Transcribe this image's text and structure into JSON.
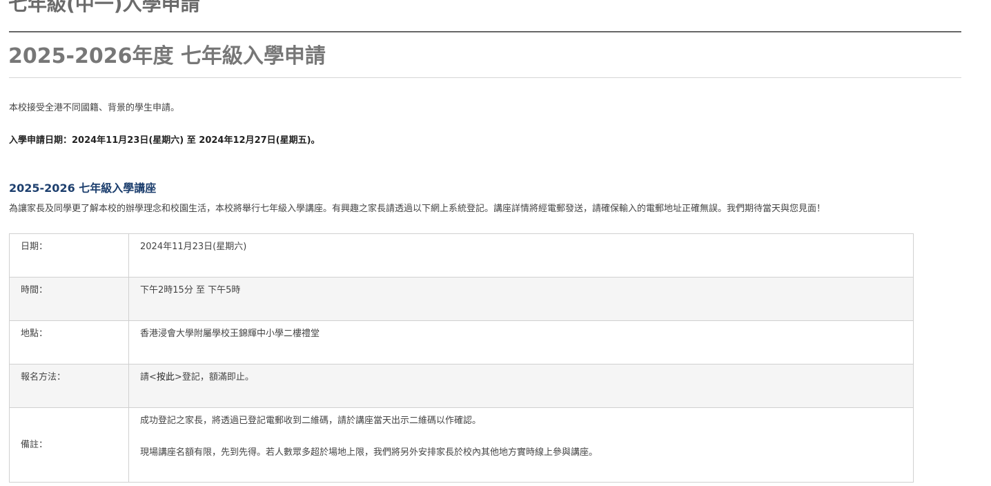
{
  "page": {
    "heading": "七年級(中一)入學申請",
    "subheading": "2025-2026年度 七年級入學申請",
    "intro": "本校接受全港不同國籍、背景的學生申請。",
    "application_period": "入學申請日期：2024年11月23日(星期六) 至 2024年12月27日(星期五)。"
  },
  "seminar": {
    "title": "2025-2026 七年級入學講座",
    "description": "為讓家長及同學更了解本校的辦學理念和校園生活，本校將舉行七年級入學講座。有興趣之家長請透過以下網上系統登記。講座詳情將經電郵發送，請確保輸入的電郵地址正確無誤。我們期待當天與您見面！",
    "table": {
      "date_label": "日期：",
      "date_value": "2024年11月23日(星期六)",
      "time_label": "時間：",
      "time_value": "下午2時15分 至 下午5時",
      "venue_label": "地點：",
      "venue_value": "香港浸會大學附屬學校王錦輝中小學二樓禮堂",
      "registration_label": "報名方法：",
      "registration_prefix": "請<",
      "registration_link": "按此",
      "registration_suffix": ">登記，額滿即止。",
      "notes_label": "備註：",
      "notes_line1": "成功登記之家長，將透過已登記電郵收到二維碼，請於講座當天出示二維碼以作確認。",
      "notes_line2": "現場講座名額有限，先到先得。若人數眾多超於場地上限，我們將另外安排家長於校內其他地方實時線上參與講座。"
    }
  }
}
